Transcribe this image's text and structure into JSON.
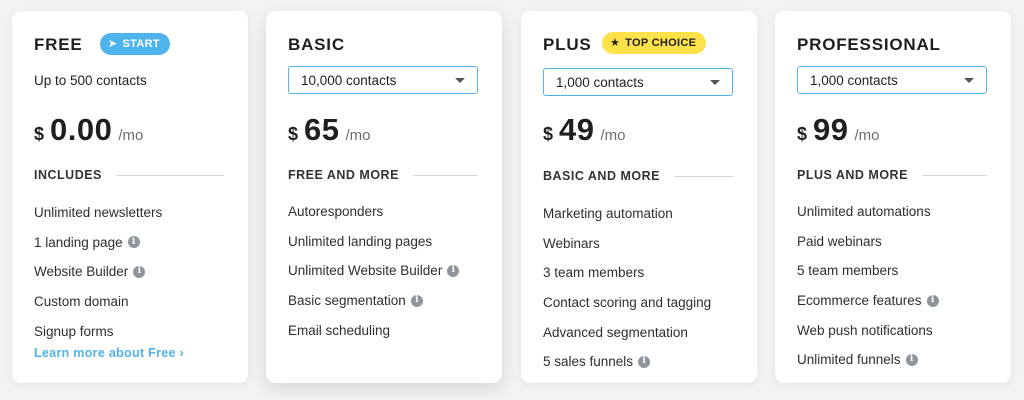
{
  "plans": [
    {
      "name": "FREE",
      "badge": "START",
      "badge_icon": "rocket-icon",
      "contacts_text": "Up to 500 contacts",
      "currency": "$",
      "price": "0.00",
      "period": "/mo",
      "section": "INCLUDES",
      "features": [
        {
          "label": "Unlimited newsletters",
          "info": false
        },
        {
          "label": "1 landing page",
          "info": true
        },
        {
          "label": "Website Builder",
          "info": true
        },
        {
          "label": "Custom domain",
          "info": false
        },
        {
          "label": "Signup forms",
          "info": false
        }
      ],
      "link": "Learn more about Free ›"
    },
    {
      "name": "BASIC",
      "contacts_select": "10,000 contacts",
      "currency": "$",
      "price": "65",
      "period": "/mo",
      "section": "FREE AND MORE",
      "features": [
        {
          "label": "Autoresponders",
          "info": false
        },
        {
          "label": "Unlimited landing pages",
          "info": false
        },
        {
          "label": "Unlimited Website Builder",
          "info": true
        },
        {
          "label": "Basic segmentation",
          "info": true
        },
        {
          "label": "Email scheduling",
          "info": false
        }
      ]
    },
    {
      "name": "PLUS",
      "badge": "TOP CHOICE",
      "badge_icon": "star-icon",
      "contacts_select": "1,000 contacts",
      "currency": "$",
      "price": "49",
      "period": "/mo",
      "section": "BASIC AND MORE",
      "features": [
        {
          "label": "Marketing automation",
          "info": false
        },
        {
          "label": "Webinars",
          "info": false
        },
        {
          "label": "3 team members",
          "info": false
        },
        {
          "label": "Contact scoring and tagging",
          "info": false
        },
        {
          "label": "Advanced segmentation",
          "info": false
        },
        {
          "label": "5 sales funnels",
          "info": true
        }
      ]
    },
    {
      "name": "PROFESSIONAL",
      "contacts_select": "1,000 contacts",
      "currency": "$",
      "price": "99",
      "period": "/mo",
      "section": "PLUS AND MORE",
      "features": [
        {
          "label": "Unlimited automations",
          "info": false
        },
        {
          "label": "Paid webinars",
          "info": false
        },
        {
          "label": "5 team members",
          "info": false
        },
        {
          "label": "Ecommerce features",
          "info": true
        },
        {
          "label": "Web push notifications",
          "info": false
        },
        {
          "label": "Unlimited funnels",
          "info": true
        }
      ]
    }
  ],
  "colors": {
    "accent": "#4fb3ec",
    "top_choice": "#ffe24a",
    "background": "#f2f3f5",
    "card": "#ffffff",
    "info_icon": "#8f959c"
  },
  "info_glyph": "i"
}
